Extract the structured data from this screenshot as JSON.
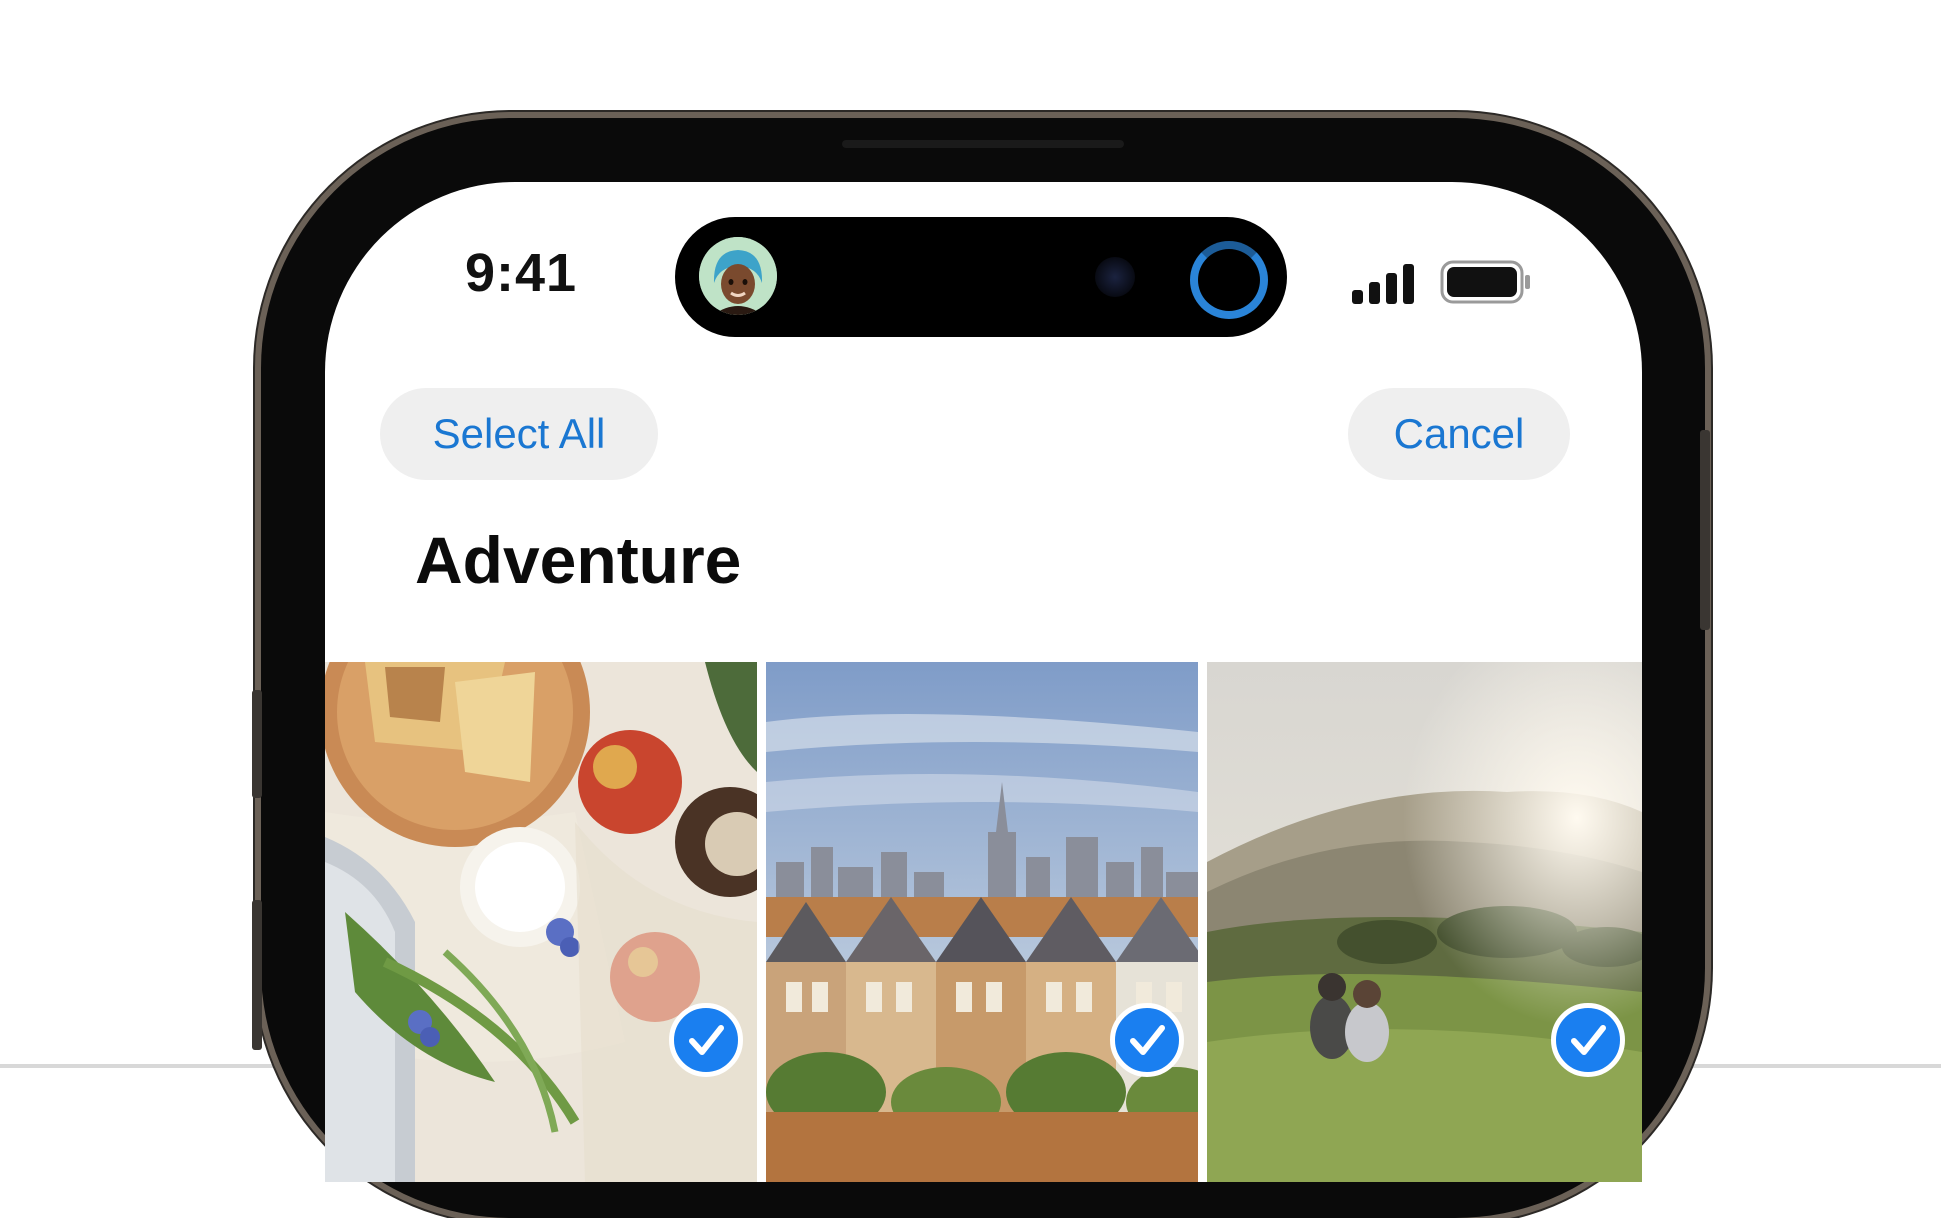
{
  "status_bar": {
    "time": "9:41",
    "island_avatar_icon": "memoji-avatar-icon",
    "island_activity_icon": "progress-ring-icon",
    "signal_icon": "cellular-signal-icon",
    "battery_icon": "battery-icon"
  },
  "nav": {
    "select_all_label": "Select All",
    "cancel_label": "Cancel"
  },
  "album": {
    "title": "Adventure",
    "photos": [
      {
        "description_icon": "picnic-photo",
        "selected": true
      },
      {
        "description_icon": "city-houses-photo",
        "selected": true
      },
      {
        "description_icon": "hillside-couple-photo",
        "selected": true
      }
    ]
  },
  "colors": {
    "accent": "#1a77d2",
    "pill_background": "#efefef",
    "check_fill": "#1a7ff0"
  }
}
